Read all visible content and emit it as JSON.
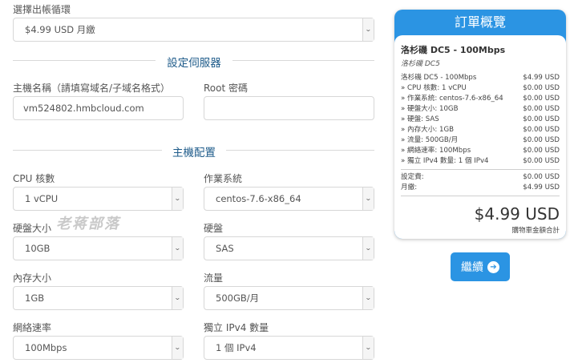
{
  "billing": {
    "label": "選擇出帳循環",
    "value": "$4.99 USD 月繳"
  },
  "server_section": {
    "title": "設定伺服器"
  },
  "hostname": {
    "label": "主機名稱（請填寫域名/子域名格式）",
    "value": "vm524802.hmbcloud.com"
  },
  "root_password": {
    "label": "Root 密碼",
    "value": ""
  },
  "host_section": {
    "title": "主機配置"
  },
  "options": {
    "cpu": {
      "label": "CPU 核數",
      "value": "1 vCPU"
    },
    "os": {
      "label": "作業系統",
      "value": "centos-7.6-x86_64"
    },
    "disk_size": {
      "label": "硬盤大小",
      "value": "10GB"
    },
    "disk_type": {
      "label": "硬盤",
      "value": "SAS"
    },
    "ram": {
      "label": "內存大小",
      "value": "1GB"
    },
    "traffic": {
      "label": "流量",
      "value": "500GB/月"
    },
    "network": {
      "label": "網絡速率",
      "value": "100Mbps"
    },
    "ipv4": {
      "label": "獨立 IPv4 數量",
      "value": "1 個 IPv4"
    }
  },
  "watermark": "老蒋部落",
  "summary": {
    "title": "訂單概覽",
    "product_name": "洛杉磯 DC5 - 100Mbps",
    "product_group": "洛杉磯 DC5",
    "lines": [
      {
        "label": "洛杉磯 DC5 - 100Mbps",
        "price": "$4.99 USD"
      },
      {
        "label": "» CPU 核數: 1 vCPU",
        "price": "$0.00 USD"
      },
      {
        "label": "» 作業系統: centos-7.6-x86_64",
        "price": "$0.00 USD"
      },
      {
        "label": "» 硬盤大小: 10GB",
        "price": "$0.00 USD"
      },
      {
        "label": "» 硬盤: SAS",
        "price": "$0.00 USD"
      },
      {
        "label": "» 內存大小: 1GB",
        "price": "$0.00 USD"
      },
      {
        "label": "» 流量: 500GB/月",
        "price": "$0.00 USD"
      },
      {
        "label": "» 網絡速率: 100Mbps",
        "price": "$0.00 USD"
      },
      {
        "label": "» 獨立 IPv4 數量: 1 個 IPv4",
        "price": "$0.00 USD"
      }
    ],
    "fees": [
      {
        "label": "設定費:",
        "price": "$0.00 USD"
      },
      {
        "label": "月繳:",
        "price": "$4.99 USD"
      }
    ],
    "total": "$4.99 USD",
    "total_label": "購物車金額合計"
  },
  "continue_button": {
    "label": "繼續",
    "icon": "arrow-circle-right-icon"
  },
  "colors": {
    "accent": "#2b94e3",
    "section_title": "#1e5b8a"
  }
}
